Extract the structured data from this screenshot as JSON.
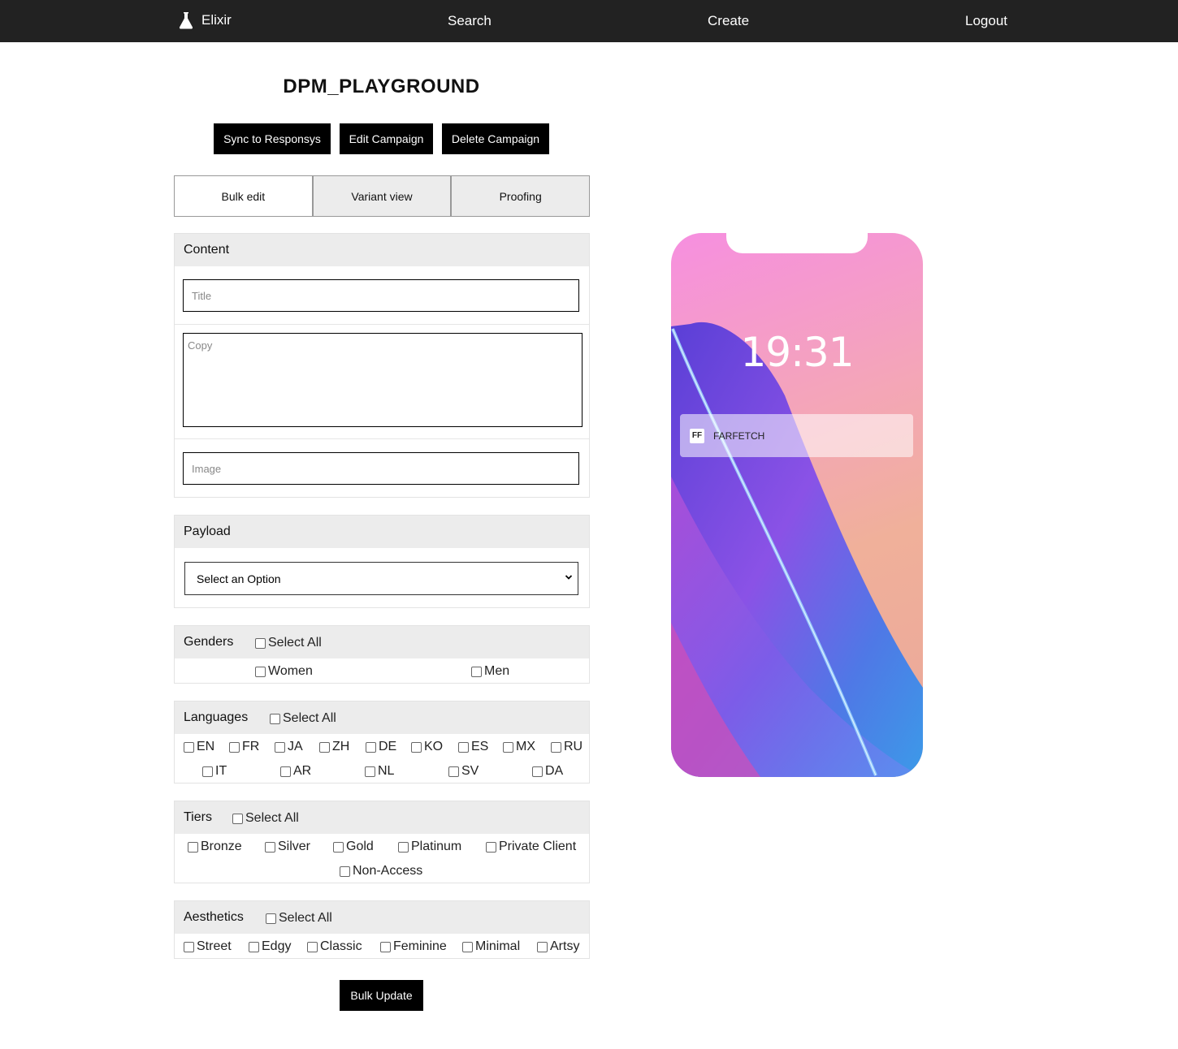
{
  "nav": {
    "brand": "Elixir",
    "search": "Search",
    "create": "Create",
    "logout": "Logout"
  },
  "page": {
    "title": "DPM_PLAYGROUND",
    "actions": {
      "sync": "Sync to Responsys",
      "edit": "Edit Campaign",
      "delete": "Delete Campaign"
    }
  },
  "tabs": [
    "Bulk edit",
    "Variant view",
    "Proofing"
  ],
  "content": {
    "heading": "Content",
    "title_placeholder": "Title",
    "copy_placeholder": "Copy",
    "image_placeholder": "Image"
  },
  "payload": {
    "heading": "Payload",
    "selected": "Select an Option"
  },
  "genders": {
    "heading": "Genders",
    "select_all": "Select All",
    "options": [
      "Women",
      "Men"
    ]
  },
  "languages": {
    "heading": "Languages",
    "select_all": "Select All",
    "options": [
      "EN",
      "FR",
      "JA",
      "ZH",
      "DE",
      "KO",
      "ES",
      "MX",
      "RU",
      "IT",
      "AR",
      "NL",
      "SV",
      "DA"
    ]
  },
  "tiers": {
    "heading": "Tiers",
    "select_all": "Select All",
    "options": [
      "Bronze",
      "Silver",
      "Gold",
      "Platinum",
      "Private Client",
      "Non-Access"
    ]
  },
  "aesthetics": {
    "heading": "Aesthetics",
    "select_all": "Select All",
    "options": [
      "Street",
      "Edgy",
      "Classic",
      "Feminine",
      "Minimal",
      "Artsy"
    ]
  },
  "bulk_update": "Bulk Update",
  "preview": {
    "time": "19:31",
    "app_name": "FARFETCH"
  }
}
